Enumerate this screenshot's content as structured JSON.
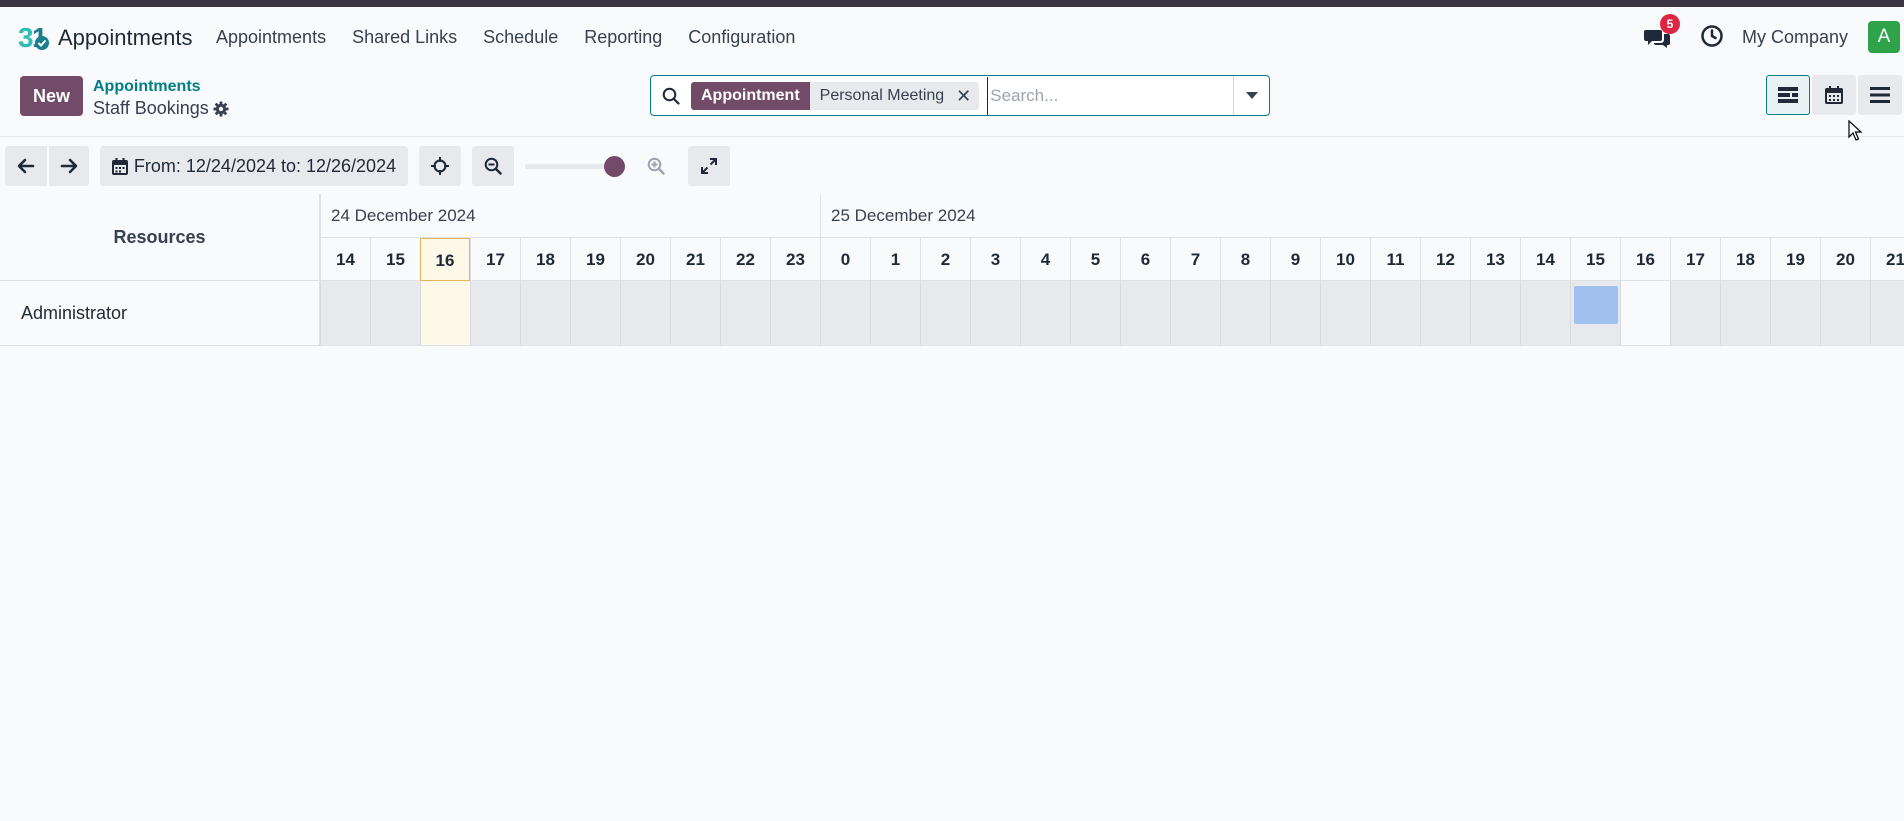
{
  "app": {
    "name": "Appointments"
  },
  "menu": [
    "Appointments",
    "Shared Links",
    "Schedule",
    "Reporting",
    "Configuration"
  ],
  "systray": {
    "messages_count": "5",
    "company": "My Company",
    "avatar_letter": "A"
  },
  "control_panel": {
    "new_label": "New",
    "breadcrumb_parent": "Appointments",
    "breadcrumb_current": "Staff Bookings",
    "search": {
      "facet_key": "Appointment",
      "facet_value": "Personal Meeting",
      "placeholder": "Search..."
    },
    "views": [
      "gantt-view-icon",
      "calendar-view-icon",
      "list-view-icon"
    ],
    "active_view": "gantt"
  },
  "gantt_toolbar": {
    "range_label": "From: 12/24/2024 to: 12/26/2024"
  },
  "gantt": {
    "resources_header": "Resources",
    "day1": "24 December 2024",
    "day2": "25 December 2024",
    "hours": [
      "14",
      "15",
      "16",
      "17",
      "18",
      "19",
      "20",
      "21",
      "22",
      "23",
      "0",
      "1",
      "2",
      "3",
      "4",
      "5",
      "6",
      "7",
      "8",
      "9",
      "10",
      "11",
      "12",
      "13",
      "14",
      "15",
      "16",
      "17",
      "18",
      "19",
      "20",
      "21"
    ],
    "today_hour_index": 2,
    "rows": [
      {
        "name": "Administrator",
        "booked_hour_index": 25,
        "available_hour_index": 26
      }
    ]
  },
  "colors": {
    "brand": "#714b67",
    "accent": "#017e84",
    "booked": "#a0c0ed",
    "badge": "#dc2643"
  }
}
